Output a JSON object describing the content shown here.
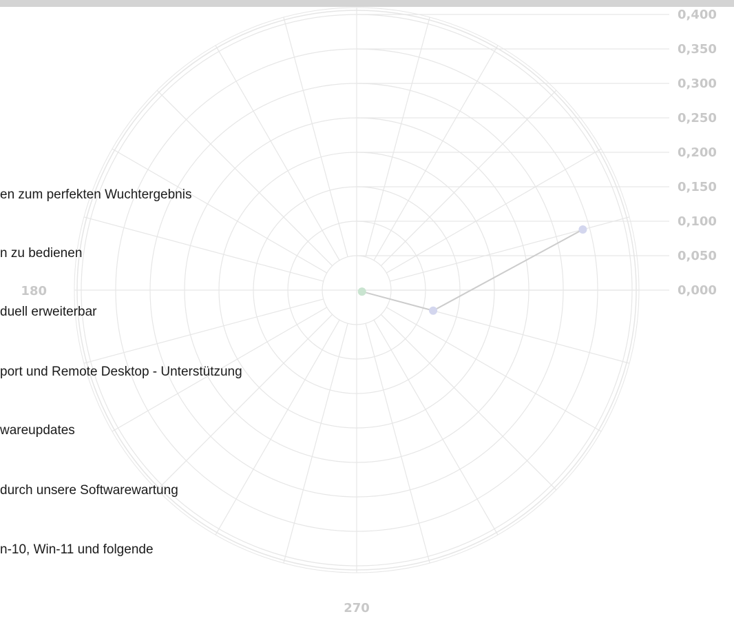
{
  "features": [
    "en zum perfekten Wuchtergebnis",
    "n zu bedienen",
    "duell erweiterbar",
    "port und Remote Desktop - Unterstützung",
    "wareupdates",
    "durch unsere Softwarewartung",
    "n-10, Win-11 und folgende"
  ],
  "chart_data": {
    "type": "polar-scatter",
    "radial_ticks": [
      "0,000",
      "0,050",
      "0,100",
      "0,150",
      "0,200",
      "0,250",
      "0,300",
      "0,350",
      "0,400"
    ],
    "rlim": [
      0,
      0.4
    ],
    "angle_ticks": [
      "180",
      "270"
    ],
    "angle_unit": "deg",
    "angular_grid_step_deg": 15,
    "grid": true,
    "colors": {
      "grid": "#e6e6e6",
      "tick_label": "#c8c8c8",
      "line": "#cccccc"
    },
    "series": [
      {
        "color": "#c9e4d0",
        "points": [
          {
            "theta": 345,
            "r": 0.008
          }
        ]
      },
      {
        "color": "#d3d6ee",
        "points": [
          {
            "theta": 345,
            "r": 0.115
          },
          {
            "theta": 15,
            "r": 0.34
          }
        ]
      }
    ]
  }
}
